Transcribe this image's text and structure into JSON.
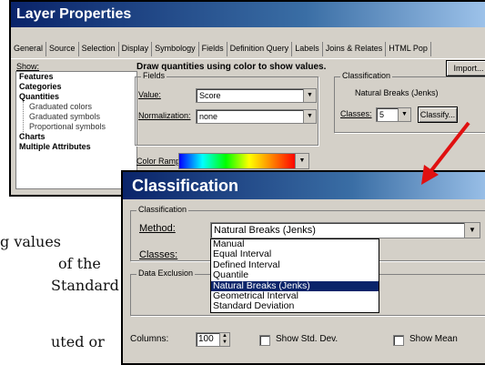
{
  "background_text": {
    "line1": "g values",
    "line2": "of the",
    "line3": "Standard",
    "line4": "uted or"
  },
  "layer_properties": {
    "title": "Layer Properties",
    "tabs": [
      "General",
      "Source",
      "Selection",
      "Display",
      "Symbology",
      "Fields",
      "Definition Query",
      "Labels",
      "Joins & Relates",
      "HTML Pop"
    ],
    "active_tab": "Symbology",
    "show_label": "Show:",
    "show_items": [
      {
        "label": "Features",
        "style": "bold"
      },
      {
        "label": "Categories",
        "style": "bold"
      },
      {
        "label": "Quantities",
        "style": "bold"
      },
      {
        "label": "Graduated colors",
        "style": "sub"
      },
      {
        "label": "Graduated symbols",
        "style": "sub"
      },
      {
        "label": "Proportional symbols",
        "style": "sub"
      },
      {
        "label": "Charts",
        "style": "bold"
      },
      {
        "label": "Multiple Attributes",
        "style": "bold"
      }
    ],
    "heading": "Draw quantities using color to show values.",
    "import_button": "Import...",
    "fields_group": "Fields",
    "value_label": "Value:",
    "value": "Score",
    "normalization_label": "Normalization:",
    "normalization": "none",
    "classification_group": "Classification",
    "classification_method": "Natural Breaks (Jenks)",
    "classes_label": "Classes:",
    "classes": "5",
    "classify_button": "Classify...",
    "color_ramp_label": "Color Ramp:"
  },
  "classification_dialog": {
    "title": "Classification",
    "group": "Classification",
    "method_label": "Method:",
    "method_value": "Natural Breaks (Jenks)",
    "classes_label": "Classes:",
    "methods": [
      "Manual",
      "Equal Interval",
      "Defined Interval",
      "Quantile",
      "Natural Breaks (Jenks)",
      "Geometrical Interval",
      "Standard Deviation"
    ],
    "selected_method_index": 4,
    "data_exclusion_label": "Data Exclusion",
    "columns_label": "Columns:",
    "columns_value": "100",
    "show_std_dev": "Show Std. Dev.",
    "show_mean": "Show Mean"
  },
  "colors": {
    "title_bar": "#0a246a",
    "window_bg": "#d4d0c8",
    "selection": "#0a246a",
    "arrow": "#e01010"
  }
}
